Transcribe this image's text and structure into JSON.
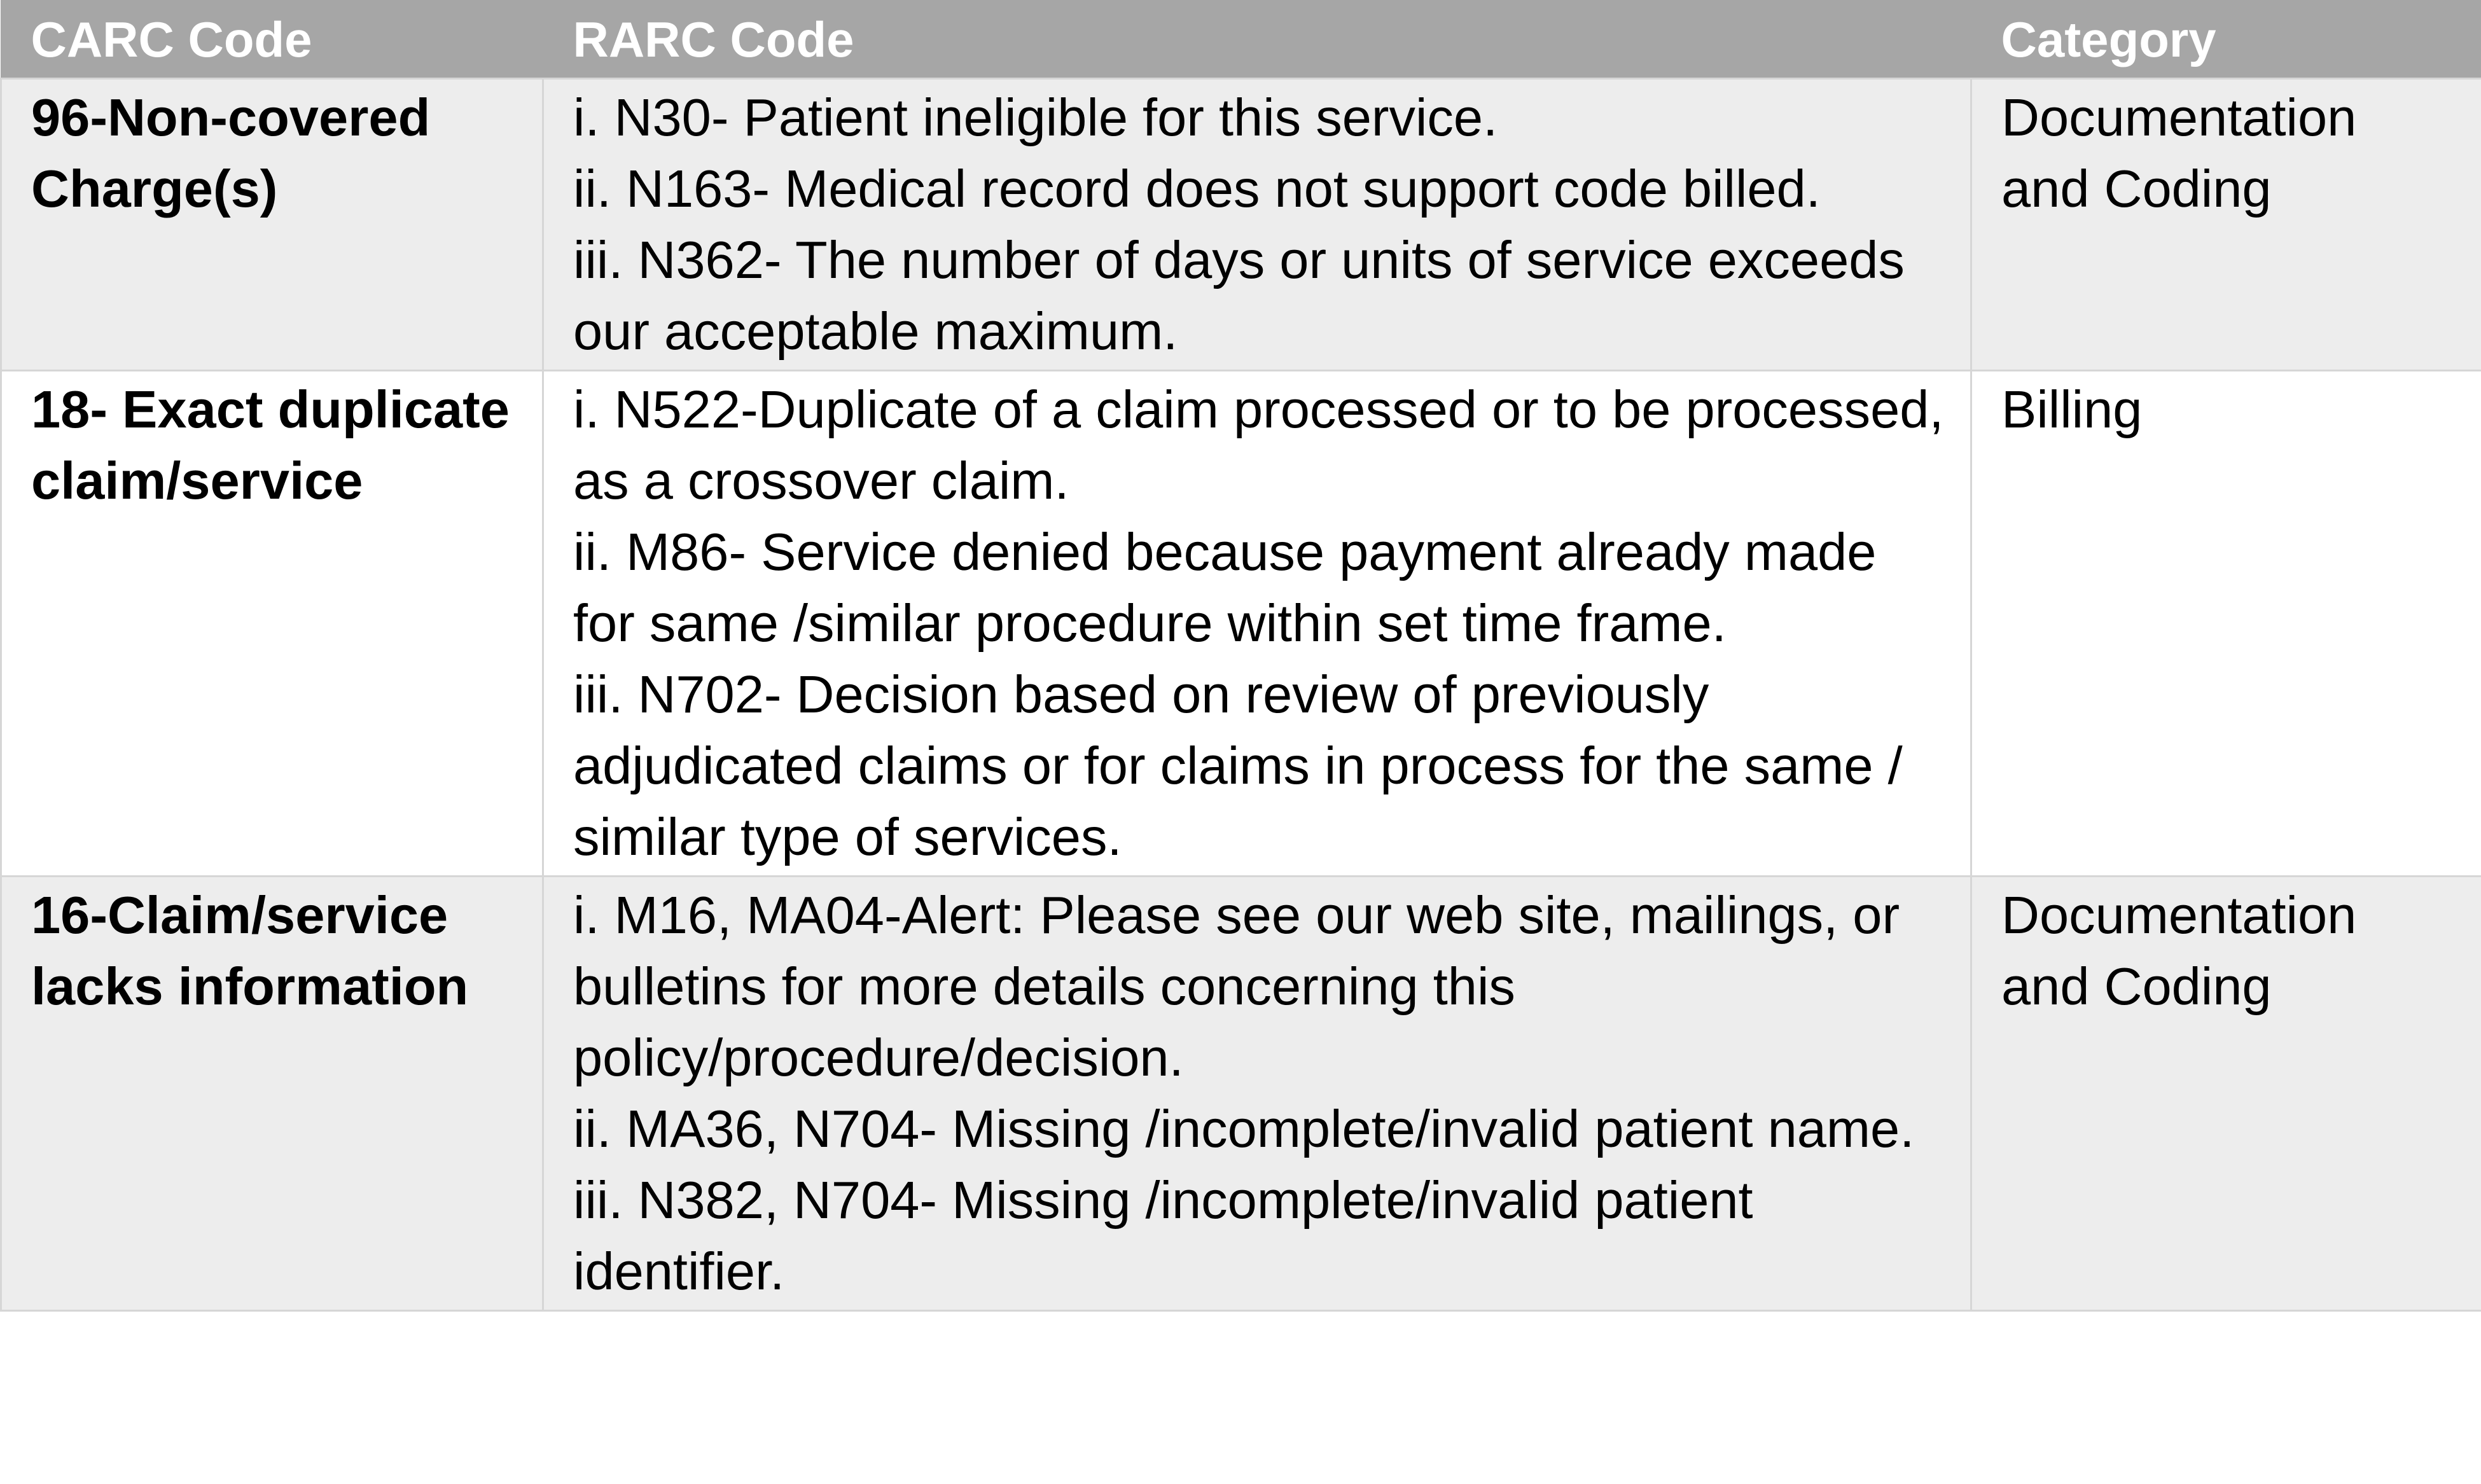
{
  "table": {
    "headers": {
      "carc": "CARC Code",
      "rarc": "RARC Code",
      "category": "Category"
    },
    "rows": [
      {
        "carc": "96-Non-covered Charge(s)",
        "rarc": [
          "i. N30- Patient ineligible for this service.",
          "ii. N163- Medical record does not support code billed.",
          "iii. N362- The number of days or units of service exceeds our acceptable maximum."
        ],
        "category": "Documentation and Coding"
      },
      {
        "carc": "18- Exact duplicate claim/service",
        "rarc": [
          "i. N522-Duplicate of a claim processed or to be processed, as a crossover claim.",
          "ii. M86- Service denied because payment already made for same /similar procedure within set time frame.",
          "iii. N702- Decision based on review of previously adjudicated claims or for claims in process for the same / similar type of services."
        ],
        "category": "Billing"
      },
      {
        "carc": "16-Claim/service lacks information",
        "rarc": [
          "i. M16, MA04-Alert: Please see our web site, mailings, or bulletins for more details concerning this policy/procedure/decision.",
          "ii. MA36, N704- Missing /incomplete/invalid patient name.",
          "iii. N382, N704- Missing /incomplete/invalid patient identifier."
        ],
        "category": "Documentation and Coding"
      }
    ]
  }
}
